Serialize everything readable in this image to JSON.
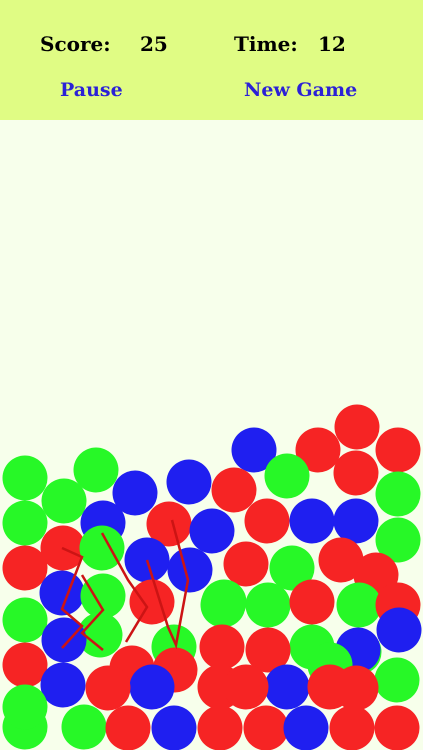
{
  "hud": {
    "score_label": "Score:",
    "score_value": "25",
    "time_label": "Time:",
    "time_value": "12",
    "pause_label": "Pause",
    "new_game_label": "New Game"
  },
  "colors": {
    "header_bg": "#e0fc84",
    "board_bg": "#f7ffeb",
    "red": "#f62424",
    "green": "#27f827",
    "blue": "#1f1ff0",
    "button_text": "#2b21d6",
    "trail": "#cc1414"
  },
  "board": {
    "ball_colors_legend": [
      "red",
      "green",
      "blue"
    ],
    "balls": [
      {
        "color": "red"
      },
      {
        "color": "blue"
      },
      {
        "color": "red"
      },
      {
        "color": "red"
      },
      {
        "color": "red"
      },
      {
        "color": "green"
      },
      {
        "color": "green"
      },
      {
        "color": "green"
      },
      {
        "color": "blue"
      },
      {
        "color": "blue"
      },
      {
        "color": "red"
      },
      {
        "color": "green"
      },
      {
        "color": "green"
      },
      {
        "color": "green"
      },
      {
        "color": "blue"
      },
      {
        "color": "red"
      },
      {
        "color": "blue"
      },
      {
        "color": "red"
      },
      {
        "color": "blue"
      },
      {
        "color": "blue"
      },
      {
        "color": "green"
      },
      {
        "color": "red"
      },
      {
        "color": "green"
      },
      {
        "color": "blue"
      },
      {
        "color": "red"
      },
      {
        "color": "blue"
      },
      {
        "color": "red"
      },
      {
        "color": "green"
      },
      {
        "color": "red"
      },
      {
        "color": "red"
      },
      {
        "color": "green"
      },
      {
        "color": "green"
      },
      {
        "color": "blue"
      },
      {
        "color": "green"
      },
      {
        "color": "red"
      },
      {
        "color": "green"
      },
      {
        "color": "green"
      },
      {
        "color": "red"
      },
      {
        "color": "green"
      },
      {
        "color": "red"
      },
      {
        "color": "green"
      },
      {
        "color": "blue"
      },
      {
        "color": "green"
      },
      {
        "color": "blue"
      },
      {
        "color": "red"
      },
      {
        "color": "red"
      },
      {
        "color": "green"
      },
      {
        "color": "red"
      },
      {
        "color": "red"
      },
      {
        "color": "green"
      },
      {
        "color": "blue"
      },
      {
        "color": "green"
      },
      {
        "color": "red"
      },
      {
        "color": "blue"
      },
      {
        "color": "red"
      },
      {
        "color": "red"
      },
      {
        "color": "blue"
      },
      {
        "color": "red"
      },
      {
        "color": "blue"
      },
      {
        "color": "red"
      },
      {
        "color": "green"
      },
      {
        "color": "green"
      },
      {
        "color": "green"
      },
      {
        "color": "red"
      },
      {
        "color": "blue"
      },
      {
        "color": "red"
      },
      {
        "color": "red"
      },
      {
        "color": "blue"
      },
      {
        "color": "red"
      },
      {
        "color": "red"
      },
      {
        "color": "green"
      },
      {
        "color": "red"
      }
    ]
  }
}
